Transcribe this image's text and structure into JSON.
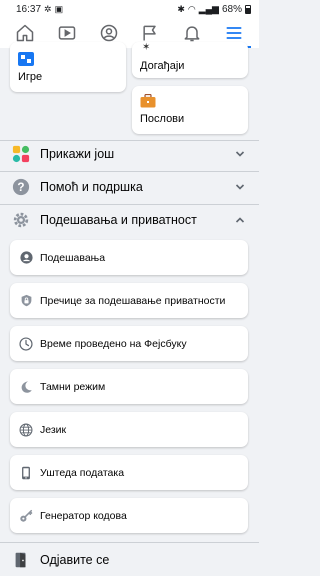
{
  "status_bar": {
    "time": "16:37",
    "battery": "68%"
  },
  "nav": {
    "items": [
      {
        "name": "home",
        "icon": "home-icon"
      },
      {
        "name": "watch",
        "icon": "video-icon"
      },
      {
        "name": "profile",
        "icon": "profile-icon"
      },
      {
        "name": "pages",
        "icon": "flag-icon"
      },
      {
        "name": "notifications",
        "icon": "bell-icon"
      },
      {
        "name": "menu",
        "icon": "hamburger-menu-icon",
        "active": true
      }
    ],
    "accent_color": "#1877f2"
  },
  "shortcuts": {
    "games": {
      "label": "Игре",
      "icon": "games-icon"
    },
    "events": {
      "label": "Догађаји",
      "icon": "events-icon"
    },
    "jobs": {
      "label": "Послови",
      "icon": "briefcase-icon"
    }
  },
  "sections": {
    "see_more": {
      "label": "Прикажи још",
      "icon": "apps-icon",
      "expanded": false
    },
    "help": {
      "label": "Помоћ и подршка",
      "icon": "question-icon",
      "expanded": false
    },
    "settings_privacy": {
      "label": "Подешавања и приватност",
      "icon": "gear-icon",
      "expanded": true
    }
  },
  "settings_items": [
    {
      "label": "Подешавања",
      "icon": "user-settings-icon"
    },
    {
      "label": "Пречице за подешавање приватности",
      "icon": "privacy-lock-icon"
    },
    {
      "label": "Време проведено на Фејсбуку",
      "icon": "clock-icon"
    },
    {
      "label": "Тамни режим",
      "icon": "moon-icon"
    },
    {
      "label": "Језик",
      "icon": "globe-icon"
    },
    {
      "label": "Уштеда података",
      "icon": "phone-icon"
    },
    {
      "label": "Генератор кодова",
      "icon": "key-icon"
    }
  ],
  "logout": {
    "label": "Одјавите се",
    "icon": "door-exit-icon"
  }
}
